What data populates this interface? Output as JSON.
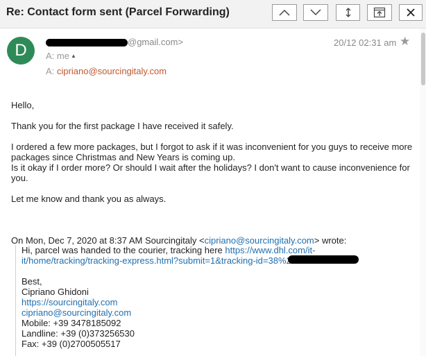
{
  "header": {
    "subject": "Re: Contact form sent (Parcel Forwarding)",
    "buttons": [
      {
        "name": "previous-message-button",
        "icon": "chevron-up-icon"
      },
      {
        "name": "next-message-button",
        "icon": "chevron-down-icon"
      },
      {
        "name": "expand-button",
        "icon": "expand-vertical-icon"
      },
      {
        "name": "pop-out-button",
        "icon": "pop-out-icon"
      },
      {
        "name": "close-button",
        "icon": "close-icon"
      }
    ]
  },
  "message": {
    "avatar_letter": "D",
    "sender_email_suffix": "@gmail.com>",
    "date": "20/12 02:31 am",
    "to_label": "A:",
    "to_value": "me",
    "cc_label": "A:",
    "cc_value": "cipriano@sourcingitaly.com"
  },
  "body": {
    "greeting": "Hello,",
    "p1": "Thank you for the first package I have received it safely.",
    "p2a": "I ordered a few more packages, but I forgot to ask if it was inconvenient for you guys to receive more packages since Christmas and New Years is coming up.",
    "p2b": "Is it okay if I order more? Or should I wait after the holidays? I don't want to cause inconvenience for you.",
    "p3": "Let me know and thank you as always.",
    "quote_intro_prefix": "On Mon, Dec 7, 2020 at 8:37 AM Sourcingitaly <",
    "quote_intro_email": "cipriano@sourcingitaly.com",
    "quote_intro_suffix": "> wrote:"
  },
  "quote": {
    "line1_text": "Hi, parcel was handed to the courier, tracking here ",
    "line1_link": "https://www.dhl.com/it-it/home/tracking/tracking-express.html?submit=1&tracking-id=38%20",
    "signoff": "Best,",
    "name": "Cipriano Ghidoni",
    "website": "https://sourcingitaly.com",
    "email": "cipriano@sourcingitaly.com",
    "mobile": "Mobile: +39 3478185092",
    "landline": "Landline: +39 (0)373256530",
    "fax": "Fax: +39 (0)2700505517"
  },
  "colors": {
    "avatar": "#2e8b57",
    "link": "#1f6fb0",
    "cc_link": "#c0582d"
  }
}
